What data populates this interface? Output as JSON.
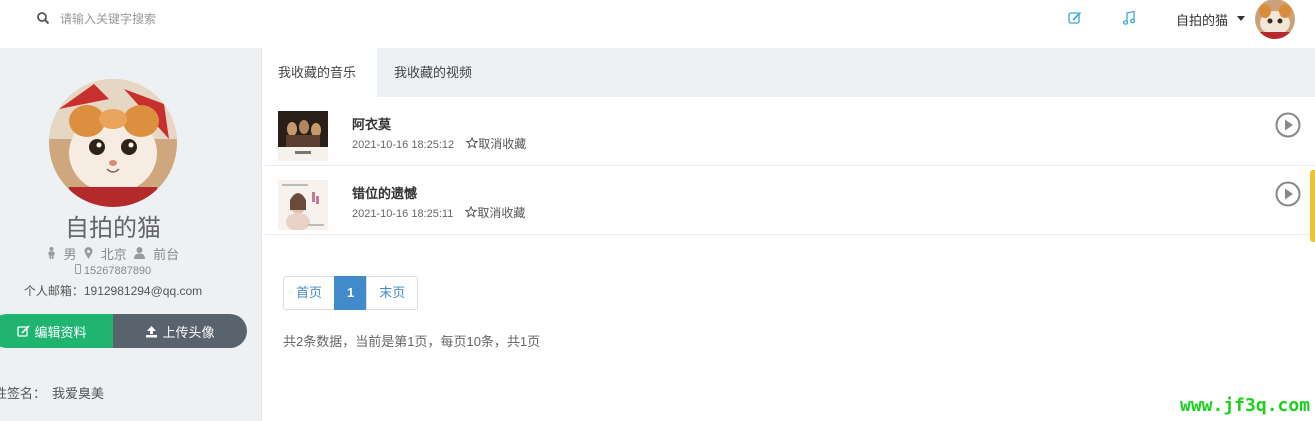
{
  "header": {
    "search_placeholder": "请输入关键字搜索",
    "user_name": "自拍的猫",
    "icons": [
      "search-icon",
      "edit-icon",
      "music-icon",
      "caret-down-icon"
    ]
  },
  "sidebar": {
    "name": "自拍的猫",
    "gender": "男",
    "city": "北京",
    "role": "前台",
    "phone": "15267887890",
    "email_label": "个人邮箱：",
    "email": "1912981294@qq.com",
    "edit_button": "编辑资料",
    "upload_button": "上传头像",
    "signature_label": "性签名：",
    "signature": "我爱臭美"
  },
  "tabs": [
    {
      "label": "我收藏的音乐",
      "active": true
    },
    {
      "label": "我收藏的视频",
      "active": false
    }
  ],
  "favorites": [
    {
      "title": "阿衣莫",
      "time": "2021-10-16 18:25:12",
      "action": "取消收藏"
    },
    {
      "title": "错位的遗憾",
      "time": "2021-10-16 18:25:11",
      "action": "取消收藏"
    }
  ],
  "pagination": {
    "first": "首页",
    "current": "1",
    "last": "末页",
    "info": "共2条数据，当前是第1页，每页10条，共1页"
  },
  "watermark": "www.jf3q.com",
  "colors": {
    "accent": "#428bca",
    "edit_button": "#1fb571",
    "upload_button": "#59636d",
    "sidebar_bg": "#eef1f3",
    "icon_blue": "#3aa8d8",
    "watermark": "#19d219"
  }
}
